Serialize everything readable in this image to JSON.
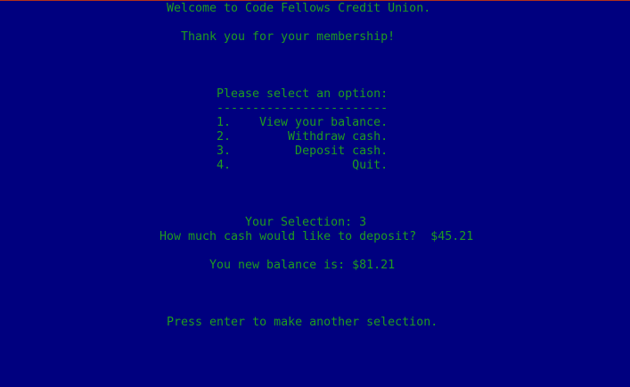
{
  "console": {
    "welcome": "Welcome to Code Fellows Credit Union.",
    "thanks": "Thank you for your membership!",
    "prompt": "Please select an option:",
    "divider": "------------------------",
    "menu": [
      {
        "text": "1.    View your balance."
      },
      {
        "text": "2.        Withdraw cash."
      },
      {
        "text": "3.         Deposit cash."
      },
      {
        "text": "4.                 Quit."
      }
    ],
    "selection": "Your Selection: 3",
    "deposit_question": "How much cash would like to deposit?  $45.21",
    "new_balance": "You new balance is: $81.21",
    "continue": "Press enter to make another selection."
  },
  "colors": {
    "background": "#00007f",
    "text": "#1f9c1f",
    "top_border": "#b4301a"
  }
}
